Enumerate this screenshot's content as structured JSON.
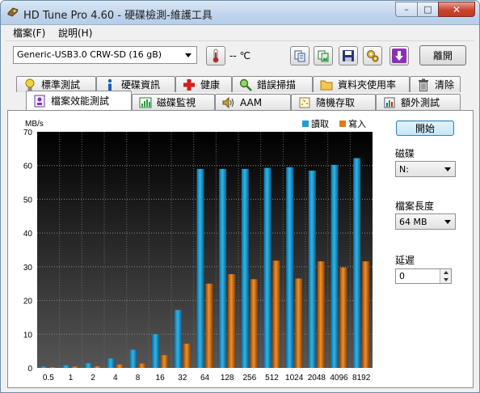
{
  "window": {
    "title": "HD Tune Pro 4.60 - 硬碟檢測-維護工具",
    "min_glyph": "–",
    "max_glyph": "□",
    "close_glyph": "✕"
  },
  "menu": [
    {
      "label": "檔案(F)"
    },
    {
      "label": "說明(H)"
    }
  ],
  "toolbar": {
    "drive": "Generic-USB3.0 CRW-SD    (16 gB)",
    "temperature": "-- ℃",
    "exit_label": "離開"
  },
  "tabs_row1": [
    {
      "label": "標準測試",
      "icon": "bulb-icon"
    },
    {
      "label": "硬碟資訊",
      "icon": "info-icon"
    },
    {
      "label": "健康",
      "icon": "health-cross-icon"
    },
    {
      "label": "錯誤掃描",
      "icon": "magnifier-icon"
    },
    {
      "label": "資料夾使用率",
      "icon": "folder-icon"
    },
    {
      "label": "清除",
      "icon": "trash-icon"
    }
  ],
  "tabs_row2": [
    {
      "label": "檔案效能測試",
      "icon": "file-benchmark-icon",
      "active": true
    },
    {
      "label": "磁碟監視",
      "icon": "disk-monitor-icon"
    },
    {
      "label": "AAM",
      "icon": "speaker-icon"
    },
    {
      "label": "隨機存取",
      "icon": "random-access-icon"
    },
    {
      "label": "額外測試",
      "icon": "extra-tests-icon"
    }
  ],
  "controls": {
    "start_label": "開始",
    "disk_label": "磁碟",
    "disk_value": "N:",
    "file_length_label": "檔案長度",
    "file_length_value": "64 MB",
    "delay_label": "延遲",
    "delay_value": "0"
  },
  "colors": {
    "read": "#1e9fd3",
    "write": "#e07b14",
    "plot_bg_top": "#000000",
    "plot_bg_bottom": "#4a4a4a"
  },
  "chart_data": {
    "type": "bar",
    "ylabel": "MB/s",
    "ylim": [
      0,
      70
    ],
    "yticks": [
      0,
      10,
      20,
      30,
      40,
      50,
      60,
      70
    ],
    "categories": [
      "0.5",
      "1",
      "2",
      "4",
      "8",
      "16",
      "32",
      "64",
      "128",
      "256",
      "512",
      "1024",
      "2048",
      "4096",
      "8192"
    ],
    "series": [
      {
        "name": "讀取",
        "values": [
          0.4,
          0.8,
          1.4,
          2.8,
          5.4,
          10.0,
          17.2,
          59.0,
          59.0,
          59.0,
          59.3,
          59.5,
          58.5,
          60.2,
          62.2
        ]
      },
      {
        "name": "寫入",
        "values": [
          0.2,
          0.4,
          0.5,
          1.0,
          1.3,
          3.8,
          7.2,
          25.0,
          27.8,
          26.3,
          31.8,
          26.5,
          31.6,
          29.8,
          31.6
        ]
      }
    ],
    "legend": "top-right",
    "grid": true
  }
}
